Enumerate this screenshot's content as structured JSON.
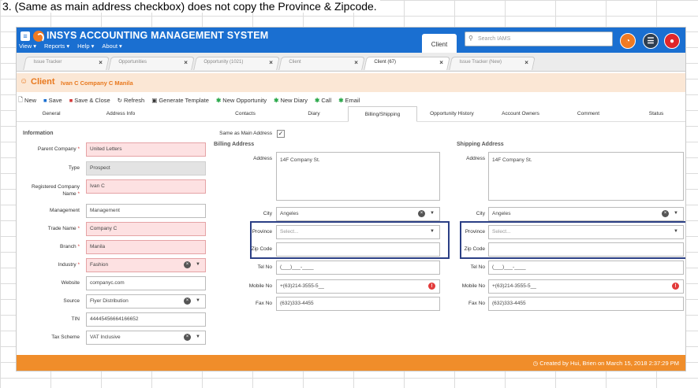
{
  "note": "3. (Same as main address checkbox) does not copy the Province & Zipcode.",
  "app": {
    "title": "INSYS ACCOUNTING MANAGEMENT SYSTEM",
    "menu": [
      "View ▾",
      "Reports ▾",
      "Help ▾",
      "About ▾"
    ],
    "client_tab": "Client",
    "search_placeholder": "Search IAMS"
  },
  "doc_tabs": [
    {
      "label": "Issue Tracker"
    },
    {
      "label": "Opportunities"
    },
    {
      "label": "Opportunity (1021)"
    },
    {
      "label": "Client"
    },
    {
      "label": "Client (67)"
    },
    {
      "label": "Issue Tracker (New)"
    }
  ],
  "header": {
    "title": "Client",
    "subtitle": "Ivan C Company C Manila"
  },
  "toolbar": [
    "New",
    "Save",
    "Save & Close",
    "Refresh",
    "Generate Template",
    "New Opportunity",
    "New Diary",
    "Call",
    "Email"
  ],
  "tabs": [
    "General",
    "Address Info",
    "Contacts",
    "Diary",
    "Billing/Shipping",
    "Opportunity History",
    "Account Owners",
    "Comment",
    "Status"
  ],
  "info": {
    "section": "Information",
    "fields": [
      {
        "label": "Parent Company",
        "value": "United Letters",
        "required": true
      },
      {
        "label": "Type",
        "value": "Prospect"
      },
      {
        "label": "Registered Company Name",
        "value": "Ivan C",
        "required": true
      },
      {
        "label": "Management",
        "value": "Management"
      },
      {
        "label": "Trade Name",
        "value": "Company C",
        "required": true
      },
      {
        "label": "Branch",
        "value": "Manila",
        "required": true
      },
      {
        "label": "Industry",
        "value": "Fashion",
        "required": true
      },
      {
        "label": "Website",
        "value": "companyc.com"
      },
      {
        "label": "Source",
        "value": "Flyer Distribution"
      },
      {
        "label": "TIN",
        "value": "44445456664166652"
      },
      {
        "label": "Tax Scheme",
        "value": "VAT Inclusive"
      }
    ]
  },
  "billing": {
    "same_as_main": "Same as Main Address",
    "section": "Billing Address",
    "labels": {
      "address": "Address",
      "city": "City",
      "province": "Province",
      "zip": "Zip Code",
      "tel": "Tel No",
      "mobile": "Mobile No",
      "fax": "Fax No"
    },
    "address": "14F Company St.",
    "city": "Angeles",
    "province_placeholder": "Select...",
    "zip": "",
    "tel": "(___)___-____",
    "mobile": "+(63)214-3555-5__",
    "fax": "(632)333-4455"
  },
  "shipping": {
    "section": "Shipping Address",
    "labels": {
      "address": "Address",
      "city": "City",
      "province": "Province",
      "zip": "Zip Code",
      "tel": "Tel No",
      "mobile": "Mobile No",
      "fax": "Fax No"
    },
    "address": "14F Company St.",
    "city": "Angeles",
    "province_placeholder": "Select...",
    "zip": "",
    "tel": "(___)___-____",
    "mobile": "+(63)214-3555-5__",
    "fax": "(632)333-4455"
  },
  "footer": "Created by Hui, Brien on March 15, 2018 2:37:29 PM"
}
